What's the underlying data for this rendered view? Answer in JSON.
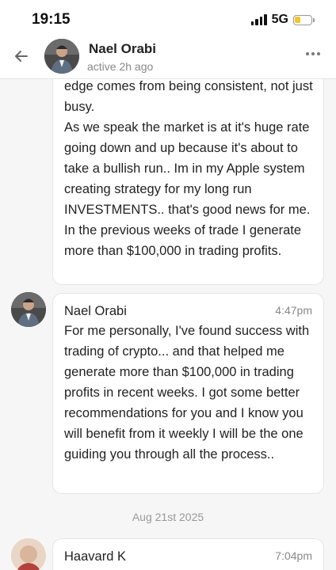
{
  "status_bar": {
    "time": "19:15",
    "network": "5G",
    "battery_level": 0.3
  },
  "header": {
    "contact_name": "Nael Orabi",
    "contact_status": "active 2h ago",
    "back_icon": "arrow-left-icon",
    "more_icon": "more-horizontal-icon"
  },
  "messages": [
    {
      "text": "edge comes from being consistent, not just busy.\nAs we speak the market is at it's huge rate going down and up because it's about to take a bullish run.. Im in my Apple system creating strategy for my long run INVESTMENTS.. that's good news for me. In the previous weeks of trade I generate more than $100,000 in trading profits."
    },
    {
      "sender": "Nael Orabi",
      "time": "4:47pm",
      "text": "For me personally, I've found success with trading of crypto... and that helped me generate more than $100,000 in trading profits in recent weeks. I got some better recommendations for you and I know you will benefit from it weekly I will be the one guiding you through all the process.."
    },
    {
      "sender": "Haavard K",
      "time": "7:04pm"
    }
  ],
  "date_separator": "Aug 21st 2025",
  "colors": {
    "bubble_bg": "#ffffff",
    "chat_bg": "#f6f6f6",
    "battery_fill": "#f4c430"
  }
}
